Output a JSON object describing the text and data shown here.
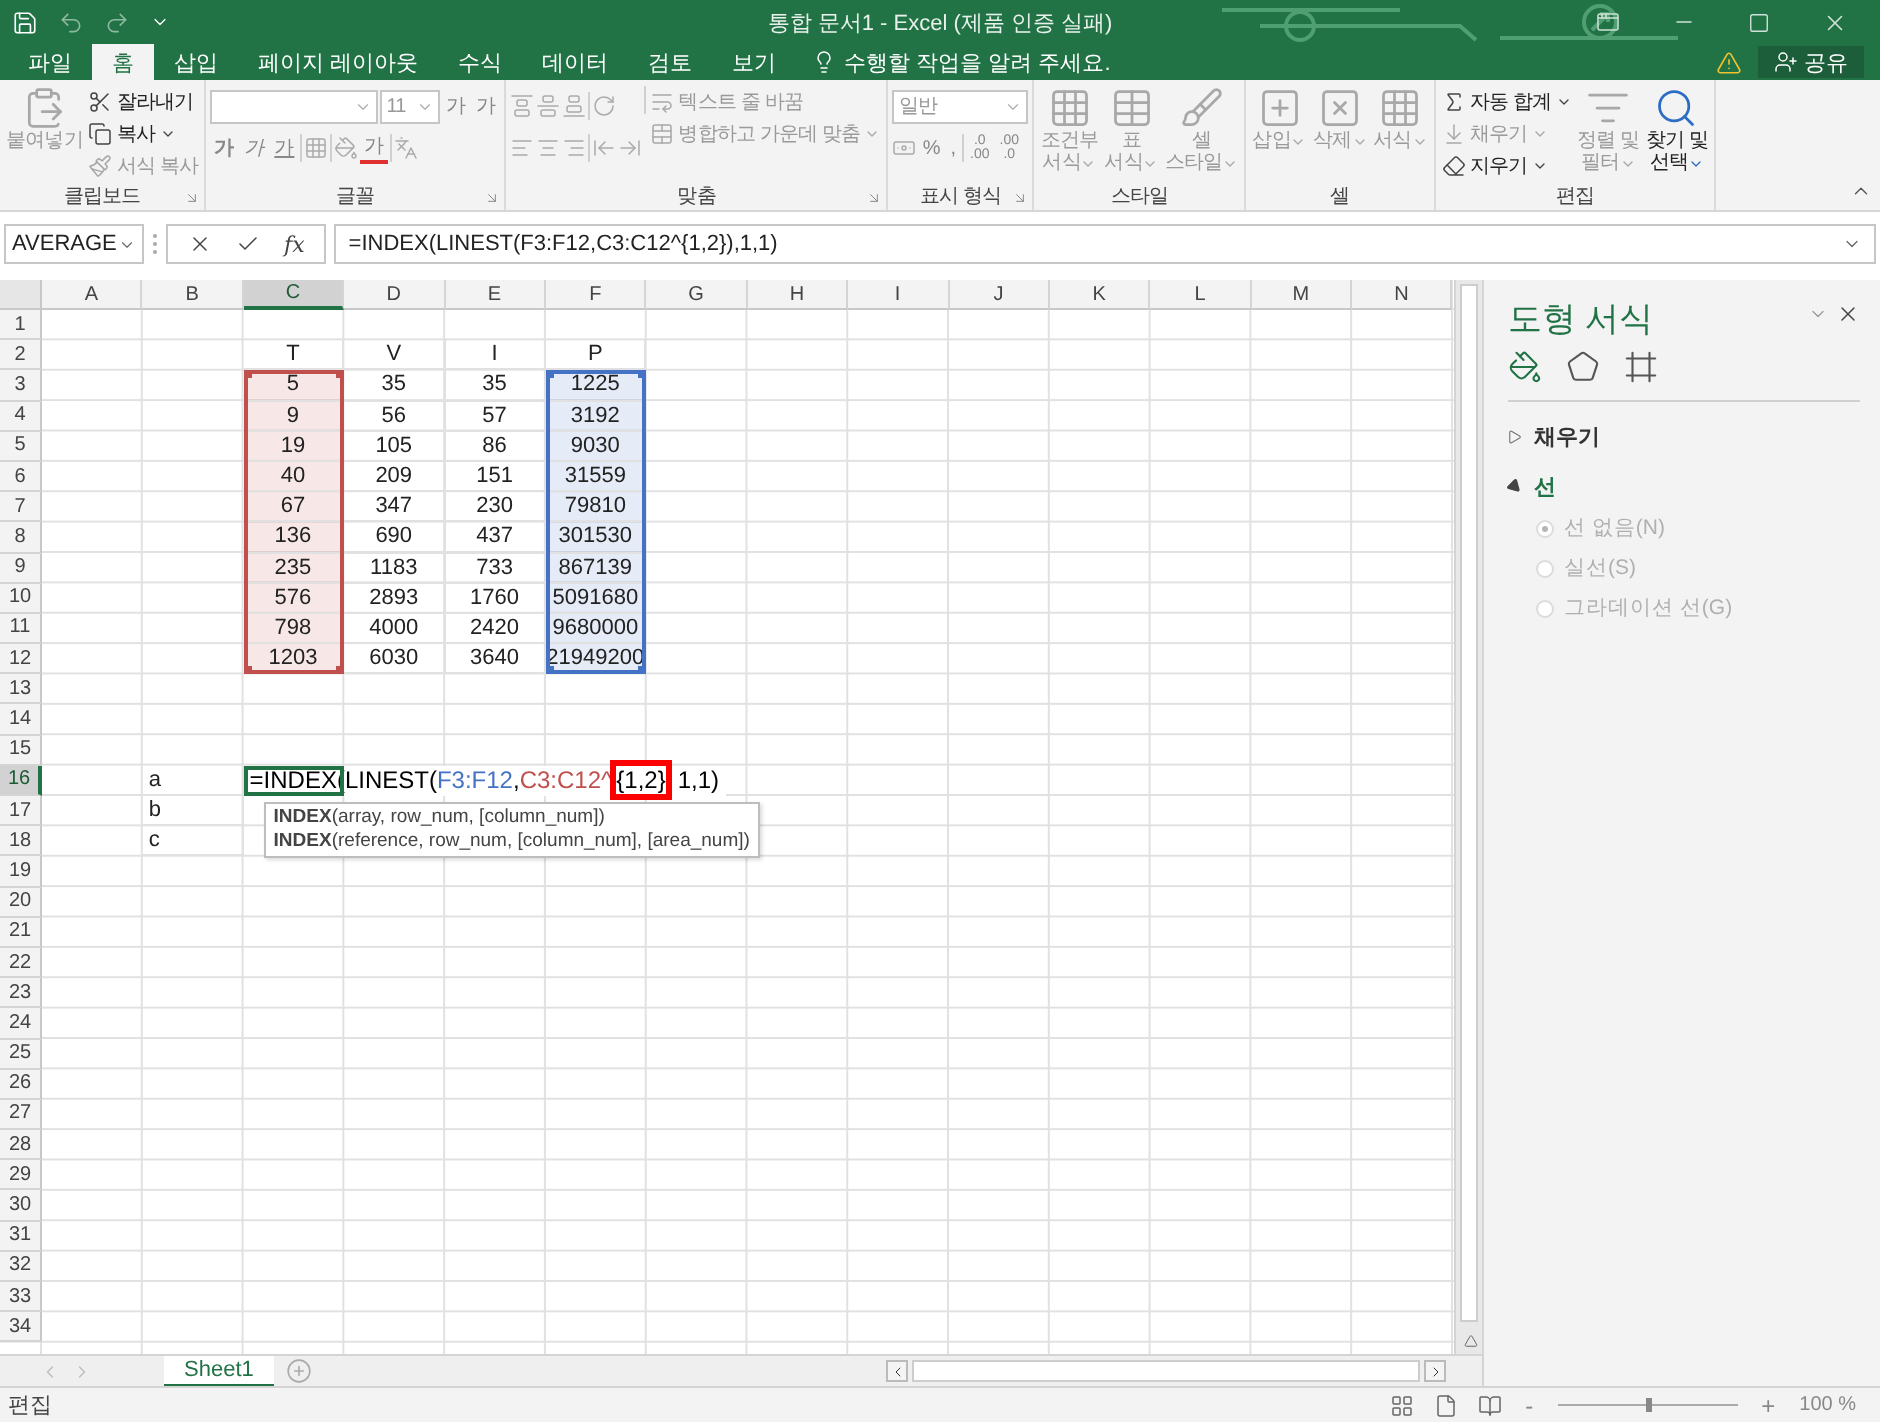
{
  "window": {
    "title": "통합 문서1 - Excel (제품 인증 실패)"
  },
  "tabs": [
    {
      "label": "파일",
      "selected": false
    },
    {
      "label": "홈",
      "selected": true
    },
    {
      "label": "삽입",
      "selected": false
    },
    {
      "label": "페이지 레이아웃",
      "selected": false
    },
    {
      "label": "수식",
      "selected": false
    },
    {
      "label": "데이터",
      "selected": false
    },
    {
      "label": "검토",
      "selected": false
    },
    {
      "label": "보기",
      "selected": false
    }
  ],
  "tell_me": {
    "placeholder": "수행할 작업을 알려 주세요."
  },
  "share_button": "공유",
  "ribbon": {
    "groups": [
      {
        "kind": "clipboard",
        "label": "클립보드",
        "buttons": [
          {
            "kind": "large",
            "lines": [
              "붙여넣기"
            ],
            "disabled": true,
            "menu": false
          },
          {
            "kind": "small",
            "lines": [
              "잘라내기"
            ],
            "disabled": false,
            "menu": false
          },
          {
            "kind": "small",
            "lines": [
              "복사"
            ],
            "disabled": false,
            "menu": true
          },
          {
            "kind": "small",
            "lines": [
              "서식 복사"
            ],
            "disabled": true,
            "menu": false
          }
        ]
      },
      {
        "kind": "font",
        "label": "글꼴",
        "font_size": "11",
        "size_buttons": [
          "가",
          "가"
        ],
        "style_buttons": [
          "가",
          "가",
          "가"
        ],
        "color_button": "가"
      },
      {
        "kind": "alignment",
        "label": "맞춤",
        "buttons": [
          {
            "kind": "small",
            "lines": [
              "텍스트 줄 바꿈"
            ],
            "disabled": true,
            "menu": false
          },
          {
            "kind": "small",
            "lines": [
              "병합하고 가운데 맞춤"
            ],
            "disabled": true,
            "menu": true
          }
        ]
      },
      {
        "kind": "number",
        "label": "표시 형식",
        "format": "일반",
        "symbols": [
          "%",
          ","
        ],
        "decimal_buttons": [
          [
            ".0",
            ".00"
          ],
          [
            ".00",
            ".0"
          ]
        ]
      },
      {
        "kind": "styles",
        "label": "스타일",
        "buttons": [
          {
            "kind": "large",
            "lines": [
              "조건부",
              "서식"
            ],
            "disabled": true,
            "menu": true
          },
          {
            "kind": "large",
            "lines": [
              "표",
              "서식"
            ],
            "disabled": true,
            "menu": true
          },
          {
            "kind": "large",
            "lines": [
              "셀",
              "스타일"
            ],
            "disabled": true,
            "menu": true
          }
        ]
      },
      {
        "kind": "cells",
        "label": "셀",
        "buttons": [
          {
            "kind": "large",
            "lines": [
              "삽입"
            ],
            "disabled": true,
            "menu": true
          },
          {
            "kind": "large",
            "lines": [
              "삭제"
            ],
            "disabled": true,
            "menu": true
          },
          {
            "kind": "large",
            "lines": [
              "서식"
            ],
            "disabled": true,
            "menu": true
          }
        ]
      },
      {
        "kind": "editing",
        "label": "편집",
        "buttons": [
          {
            "kind": "small",
            "lines": [
              "자동 합계"
            ],
            "disabled": false,
            "menu": true
          },
          {
            "kind": "small",
            "lines": [
              "채우기"
            ],
            "disabled": true,
            "menu": true
          },
          {
            "kind": "small",
            "lines": [
              "지우기"
            ],
            "disabled": false,
            "menu": true
          },
          {
            "kind": "large",
            "lines": [
              "정렬 및",
              "필터"
            ],
            "disabled": true,
            "menu": true
          },
          {
            "kind": "large",
            "lines": [
              "찾기 및",
              "선택"
            ],
            "disabled": false,
            "menu": true
          }
        ]
      }
    ]
  },
  "formula_bar": {
    "name_box": "AVERAGE",
    "function_button": "fx",
    "value": "=INDEX(LINEST(F3:F12,C3:C12^{1,2}),1,1)"
  },
  "sheet": {
    "columns": [
      {
        "label": "A",
        "selected": false
      },
      {
        "label": "B",
        "selected": false
      },
      {
        "label": "C",
        "selected": true
      },
      {
        "label": "D",
        "selected": false
      },
      {
        "label": "E",
        "selected": false
      },
      {
        "label": "F",
        "selected": false
      },
      {
        "label": "G",
        "selected": false
      },
      {
        "label": "H",
        "selected": false
      },
      {
        "label": "I",
        "selected": false
      },
      {
        "label": "J",
        "selected": false
      },
      {
        "label": "K",
        "selected": false
      },
      {
        "label": "L",
        "selected": false
      },
      {
        "label": "M",
        "selected": false
      },
      {
        "label": "N",
        "selected": false
      }
    ],
    "rows": [
      {
        "label": "1",
        "selected": false
      },
      {
        "label": "2",
        "selected": false
      },
      {
        "label": "3",
        "selected": false
      },
      {
        "label": "4",
        "selected": false
      },
      {
        "label": "5",
        "selected": false
      },
      {
        "label": "6",
        "selected": false
      },
      {
        "label": "7",
        "selected": false
      },
      {
        "label": "8",
        "selected": false
      },
      {
        "label": "9",
        "selected": false
      },
      {
        "label": "10",
        "selected": false
      },
      {
        "label": "11",
        "selected": false
      },
      {
        "label": "12",
        "selected": false
      },
      {
        "label": "13",
        "selected": false
      },
      {
        "label": "14",
        "selected": false
      },
      {
        "label": "15",
        "selected": false
      },
      {
        "label": "16",
        "selected": true
      },
      {
        "label": "17",
        "selected": false
      },
      {
        "label": "18",
        "selected": false
      },
      {
        "label": "19",
        "selected": false
      },
      {
        "label": "20",
        "selected": false
      },
      {
        "label": "21",
        "selected": false
      },
      {
        "label": "22",
        "selected": false
      },
      {
        "label": "23",
        "selected": false
      },
      {
        "label": "24",
        "selected": false
      },
      {
        "label": "25",
        "selected": false
      },
      {
        "label": "26",
        "selected": false
      },
      {
        "label": "27",
        "selected": false
      },
      {
        "label": "28",
        "selected": false
      },
      {
        "label": "29",
        "selected": false
      },
      {
        "label": "30",
        "selected": false
      },
      {
        "label": "31",
        "selected": false
      },
      {
        "label": "32",
        "selected": false
      },
      {
        "label": "33",
        "selected": false
      },
      {
        "label": "34",
        "selected": false
      }
    ],
    "table": [
      {
        "heading": "T",
        "color": "#c0504d",
        "values": [
          "5",
          "9",
          "19",
          "40",
          "67",
          "136",
          "235",
          "576",
          "798",
          "1203"
        ]
      },
      {
        "heading": "V",
        "values": [
          "35",
          "56",
          "105",
          "209",
          "347",
          "690",
          "1183",
          "2893",
          "4000",
          "6030"
        ]
      },
      {
        "heading": "I",
        "values": [
          "35",
          "57",
          "86",
          "151",
          "230",
          "437",
          "733",
          "1760",
          "2420",
          "3640"
        ]
      },
      {
        "heading": "P",
        "color": "#4472c4",
        "values": [
          "1225",
          "3192",
          "9030",
          "31559",
          "79810",
          "301530",
          "867139",
          "5091680",
          "9680000",
          "21949200"
        ]
      }
    ],
    "labels": [
      "a",
      "b",
      "c"
    ],
    "edit_segments": [
      {
        "text": "=INDEX(LINEST(",
        "color": "#000000",
        "highlighted": false
      },
      {
        "text": "F3:F12",
        "color": "#4472c4",
        "highlighted": false
      },
      {
        "text": ",",
        "color": "#000000",
        "highlighted": false
      },
      {
        "text": "C3:C12^",
        "color": "#c0504d",
        "highlighted": false
      },
      {
        "text": "{1,2}",
        "color": "#000000",
        "highlighted": true
      },
      {
        "text": "1,1)",
        "color": "#000000",
        "highlighted": false
      }
    ],
    "tooltip": [
      "**INDEX**(array, row_num, [column_num])",
      "**INDEX**(reference, row_num, [column_num], [area_num])"
    ]
  },
  "pane": {
    "title": "도형 서식",
    "tabs": [
      {
        "selected": true
      },
      {
        "selected": false
      },
      {
        "selected": false
      }
    ],
    "sections": [
      {
        "label": "채우기",
        "expanded": false
      },
      {
        "label": "선",
        "expanded": true,
        "options": [
          {
            "label": "선 없음(N)",
            "selected": true,
            "disabled": true
          },
          {
            "label": "실선(S)",
            "selected": false,
            "disabled": true
          },
          {
            "label": "그라데이션 선(G)",
            "selected": false,
            "disabled": true
          }
        ]
      }
    ]
  },
  "sheet_tabs": [
    {
      "label": "Sheet1",
      "selected": true
    }
  ],
  "status_bar": {
    "mode": "편집",
    "zoom": {
      "minus": "-",
      "plus": "+",
      "reading": "100 %",
      "level": 0.5
    }
  }
}
